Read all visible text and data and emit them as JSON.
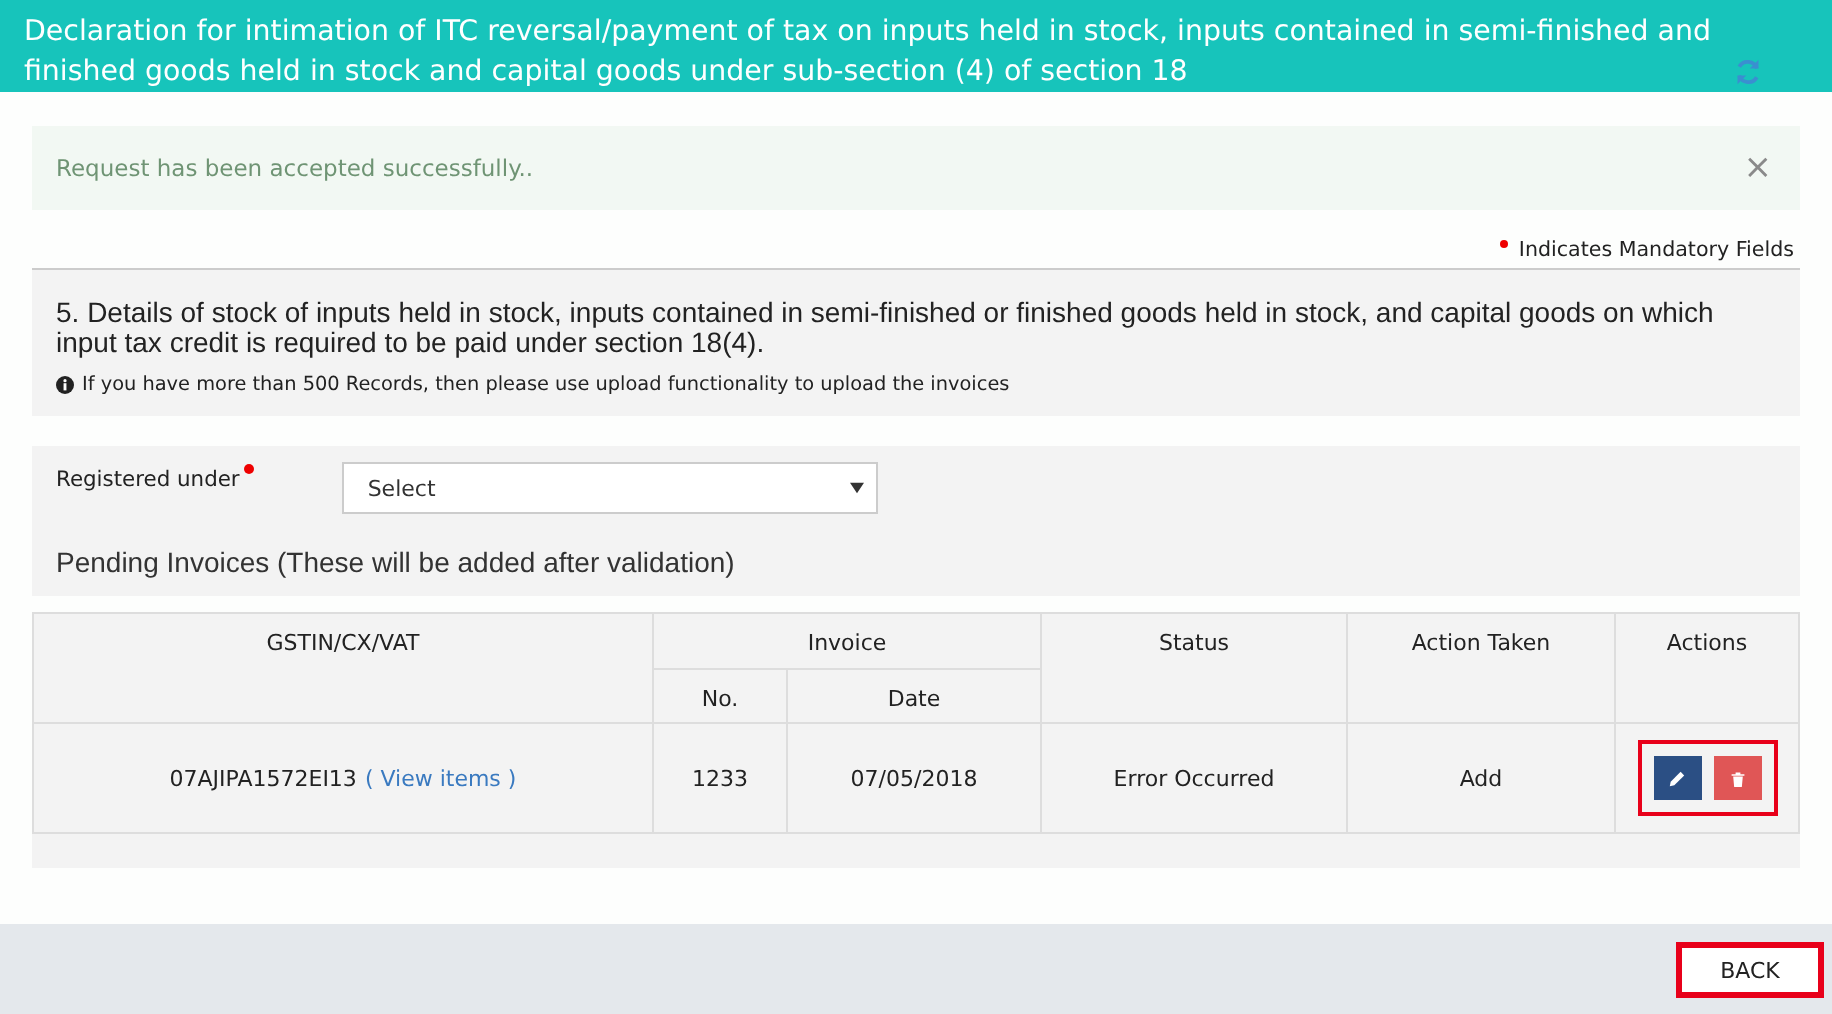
{
  "header": {
    "title": "Declaration for intimation of ITC reversal/payment of tax on inputs held in stock, inputs contained in semi-finished and finished goods held in stock and capital goods under sub-section (4) of section 18"
  },
  "alert": {
    "message": "Request has been accepted successfully..",
    "close": "×"
  },
  "mandatory_note": "Indicates Mandatory Fields",
  "section": {
    "heading": "5. Details of stock of inputs held in stock, inputs contained in semi-finished or finished goods held in stock, and capital goods on which input tax credit is required to be paid under section 18(4).",
    "info": "If you have more than 500 Records, then please use upload functionality to upload the invoices"
  },
  "registered_under": {
    "label": "Registered under",
    "required": true,
    "value": "Select"
  },
  "pending_title": "Pending Invoices (These will be added after validation)",
  "table": {
    "columns": [
      "GSTIN/CX/VAT",
      "Invoice",
      "Status",
      "Action Taken",
      "Actions"
    ],
    "subcolumns": [
      "No.",
      "Date"
    ],
    "rows": [
      {
        "gstin": "07AJIPA1572EI13",
        "link": "( View items )",
        "no": "1233",
        "date": "07/05/2018",
        "status": "Error Occurred",
        "action_taken": "Add",
        "actions_highlighted": true
      }
    ]
  },
  "back_button": {
    "label": "BACK",
    "highlighted": true
  }
}
